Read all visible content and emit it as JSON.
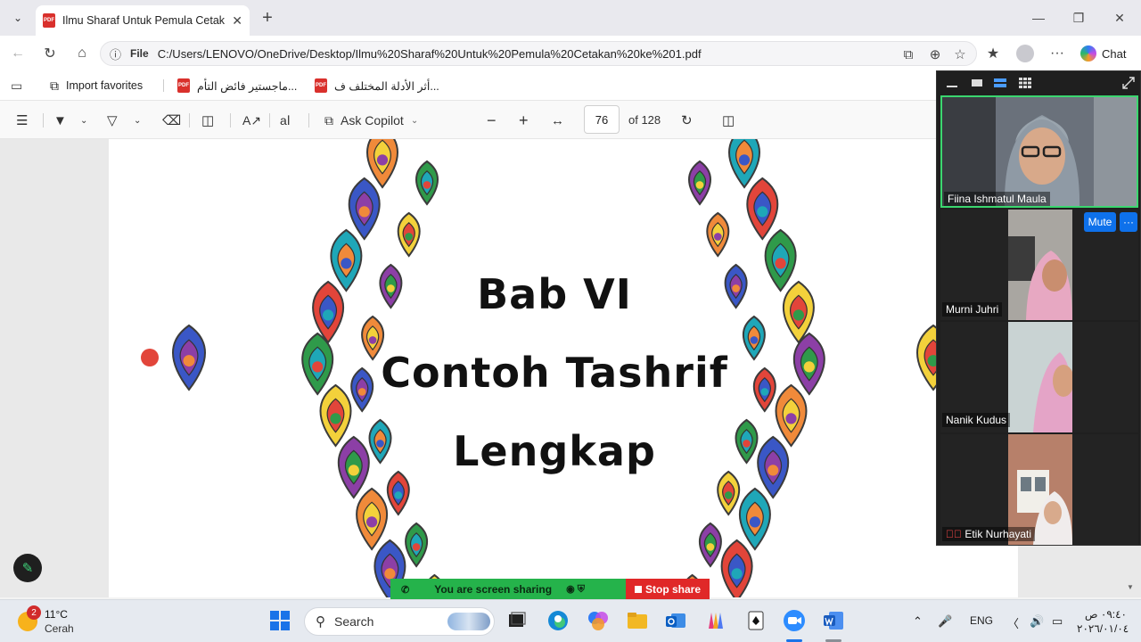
{
  "browser": {
    "tab_title": "Ilmu Sharaf Untuk Pemula Cetakan ke 1.pdf",
    "address_scheme": "File",
    "address_url": "C:/Users/LENOVO/OneDrive/Desktop/Ilmu%20Sharaf%20Untuk%20Pemula%20Cetakan%20ke%201.pdf",
    "chat_label": "Chat"
  },
  "favorites": {
    "import_label": "Import favorites",
    "items": [
      "ماجستير فائض التأم...",
      "أثر الأدلة المختلف ف..."
    ]
  },
  "pdf_toolbar": {
    "ask_copilot": "Ask Copilot",
    "page_current": "76",
    "page_total": "of 128"
  },
  "document": {
    "lines": [
      "Bab VI",
      "Contoh Tashrif",
      "Lengkap"
    ]
  },
  "zoom": {
    "participants": [
      {
        "name": "Fiina Ishmatul Maula",
        "muted": false
      },
      {
        "name": "Murni Juhri",
        "muted": false
      },
      {
        "name": "Nanik Kudus",
        "muted": false
      },
      {
        "name": "Etik Nurhayati",
        "muted": true
      }
    ],
    "mute_label": "Mute",
    "more_label": "···",
    "accent_color": "#0e71eb"
  },
  "sharing": {
    "status": "You are screen sharing",
    "stop_label": "Stop share"
  },
  "taskbar": {
    "weather_badge": "2",
    "temperature": "11°C",
    "condition": "Cerah",
    "search_placeholder": "Search",
    "language": "ENG",
    "time": "٠٩:٤٠ ص",
    "date": "٢٠٢٦/٠١/٠٤"
  }
}
